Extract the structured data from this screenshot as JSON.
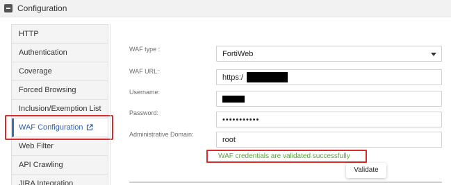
{
  "header": {
    "title": "Configuration",
    "toggle_icon": "minus-square-icon"
  },
  "sidebar": {
    "items": [
      {
        "label": "HTTP"
      },
      {
        "label": "Authentication"
      },
      {
        "label": "Coverage"
      },
      {
        "label": "Forced Browsing"
      },
      {
        "label": "Inclusion/Exemption List"
      },
      {
        "label": "WAF Configuration",
        "active": true,
        "icon": "external-link-icon"
      },
      {
        "label": "Web Filter"
      },
      {
        "label": "API Crawling"
      },
      {
        "label": "JIRA Integration"
      }
    ]
  },
  "form": {
    "waf_type": {
      "label": "WAF type :",
      "value": "FortiWeb"
    },
    "waf_url": {
      "label": "WAF URL:",
      "value": "https:/"
    },
    "username": {
      "label": "Username:",
      "value": ""
    },
    "password": {
      "label": "Password:",
      "value": "•••••••••••"
    },
    "admin_domain": {
      "label": "Administrative Domain:",
      "value": "root"
    },
    "success_message": "WAF credentials are validated successfully",
    "validate_label": "Validate"
  },
  "colors": {
    "accent": "#2a5fa8",
    "highlight": "#d62c2c",
    "success": "#5aa33b"
  }
}
